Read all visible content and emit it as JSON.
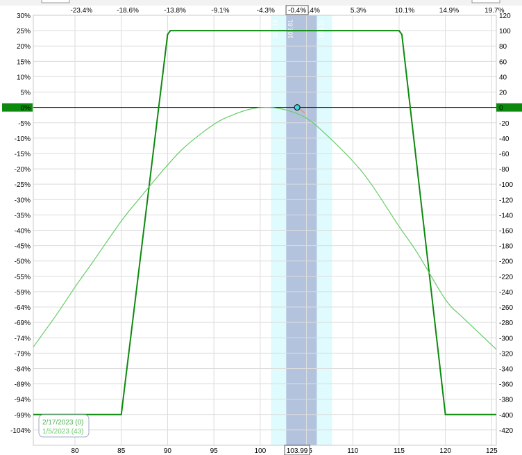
{
  "chart_data": {
    "type": "line",
    "title": "",
    "xlabel": "",
    "ylabel": "",
    "x_range": [
      75.5,
      125.5
    ],
    "x_ticks": [
      80,
      85,
      90,
      95,
      100,
      105,
      110,
      115,
      120,
      125
    ],
    "current_price_label": "103.99",
    "top_axis_ticks": [
      {
        "price": 80.7,
        "label": "-23.4%"
      },
      {
        "price": 85.7,
        "label": "-18.6%"
      },
      {
        "price": 90.8,
        "label": "-13.8%"
      },
      {
        "price": 95.7,
        "label": "-9.1%"
      },
      {
        "price": 100.6,
        "label": "-4.3%"
      },
      {
        "price": 105.6,
        "label": "0.4%"
      },
      {
        "price": 110.6,
        "label": "5.3%"
      },
      {
        "price": 115.6,
        "label": "10.1%"
      },
      {
        "price": 120.4,
        "label": "14.9%"
      },
      {
        "price": 125.3,
        "label": "19.7%"
      }
    ],
    "current_pct_label": "-0.4%",
    "left_axis_ticks": [
      "30%",
      "25%",
      "20%",
      "15%",
      "10%",
      "5%",
      "0%",
      "-5%",
      "-10%",
      "-15%",
      "-20%",
      "-25%",
      "-30%",
      "-35%",
      "-40%",
      "-45%",
      "-50%",
      "-55%",
      "-59%",
      "-64%",
      "-69%",
      "-74%",
      "-79%",
      "-84%",
      "-89%",
      "-94%",
      "-99%",
      "-104%"
    ],
    "y_range": [
      -440,
      120
    ],
    "right_axis_ticks": [
      120,
      100,
      80,
      60,
      40,
      20,
      0,
      -20,
      -40,
      -60,
      -80,
      -100,
      -120,
      -140,
      -160,
      -180,
      -200,
      -220,
      -240,
      -260,
      -280,
      -300,
      -320,
      -340,
      -360,
      -380,
      -400,
      -420
    ],
    "zero_line_value": 0,
    "zero_label_left": "0%",
    "zero_label_right": "0",
    "bands": {
      "outer": [
        101.16,
        107.76
      ],
      "inner": [
        102.81,
        106.11
      ],
      "labels": [
        "101.16",
        "102.81",
        "106.11",
        "107.76"
      ]
    },
    "current_point": {
      "x": 103.99,
      "y": 0
    },
    "series": [
      {
        "name": "2/17/2023 (0)",
        "color": "#0d8a0d",
        "points": [
          [
            75.5,
            -400
          ],
          [
            85,
            -400
          ],
          [
            90,
            95
          ],
          [
            90.3,
            100
          ],
          [
            115,
            100
          ],
          [
            115.3,
            95
          ],
          [
            120,
            -400
          ],
          [
            125.5,
            -400
          ]
        ]
      },
      {
        "name": "1/5/2023 (43)",
        "color": "#66cc66",
        "points": [
          [
            75.5,
            -312
          ],
          [
            78,
            -270
          ],
          [
            80,
            -234
          ],
          [
            82,
            -200
          ],
          [
            85,
            -148
          ],
          [
            87,
            -118
          ],
          [
            90,
            -75
          ],
          [
            92,
            -50
          ],
          [
            95,
            -22
          ],
          [
            97,
            -10
          ],
          [
            99,
            -2
          ],
          [
            101,
            0
          ],
          [
            103,
            -4
          ],
          [
            105,
            -14
          ],
          [
            107,
            -34
          ],
          [
            110,
            -70
          ],
          [
            112,
            -100
          ],
          [
            115,
            -155
          ],
          [
            117,
            -190
          ],
          [
            120,
            -250
          ],
          [
            122,
            -275
          ],
          [
            125.5,
            -315
          ]
        ]
      }
    ],
    "legend": {
      "placement": "bottom-left",
      "entries": [
        {
          "label": "2/17/2023 (0)",
          "color": "#4caf50"
        },
        {
          "label": "1/5/2023 (43)",
          "color": "#66cc66"
        }
      ]
    },
    "grid": true
  }
}
